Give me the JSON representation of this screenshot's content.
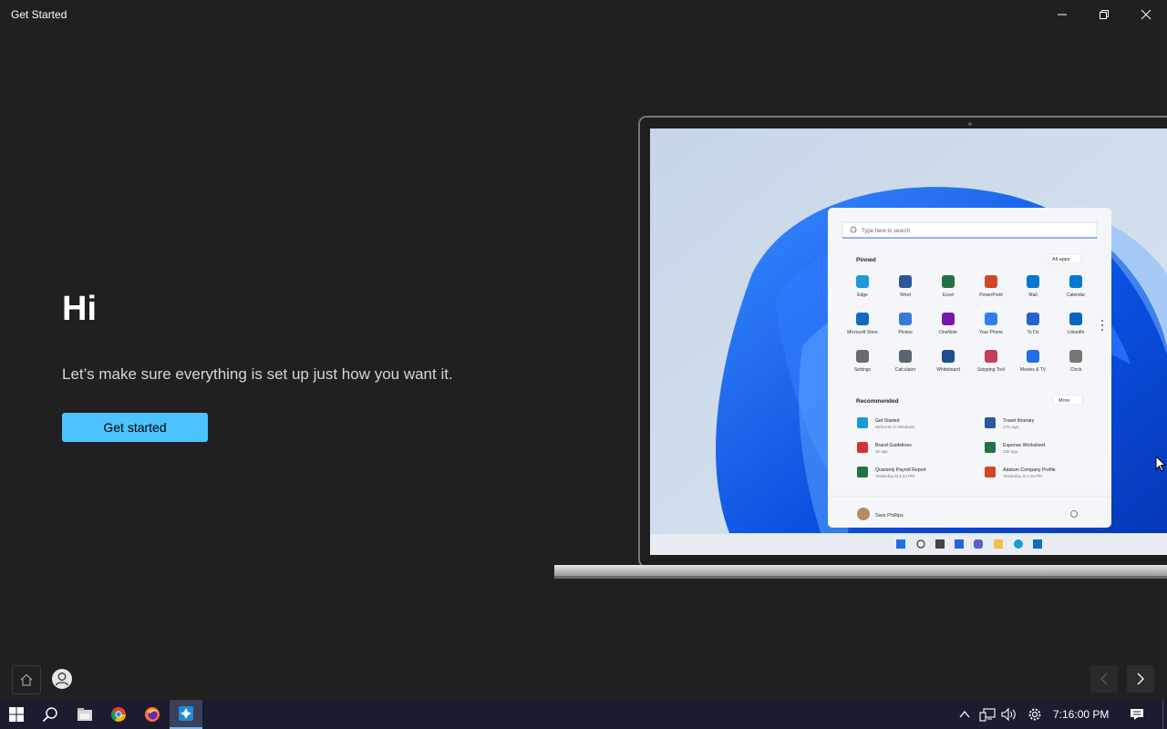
{
  "window": {
    "title": "Get Started"
  },
  "main": {
    "heading": "Hi",
    "subtitle": "Let’s make sure everything is set up just how you want it.",
    "button_label": "Get started"
  },
  "screen": {
    "search_placeholder": "Type here to search",
    "pinned_label": "Pinned",
    "all_apps_label": "All apps",
    "pinned_apps": [
      "Edge",
      "Word",
      "Excel",
      "PowerPoint",
      "Mail",
      "Calendar",
      "Microsoft Store",
      "Photos",
      "OneNote",
      "Your Phone",
      "To Do",
      "LinkedIn",
      "Settings",
      "Calculator",
      "Whiteboard",
      "Snipping Tool",
      "Movies & TV",
      "Clock"
    ],
    "recommended_label": "Recommended",
    "more_label": "More",
    "recommended": [
      {
        "title": "Get Started",
        "sub": "Welcome to Windows"
      },
      {
        "title": "Travel Itinerary",
        "sub": "17m ago"
      },
      {
        "title": "Brand Guidelines",
        "sub": "2h ago"
      },
      {
        "title": "Expense Worksheet",
        "sub": "12h ago"
      },
      {
        "title": "Quarterly Payroll Report",
        "sub": "Yesterday at 4:24 PM"
      },
      {
        "title": "Adatum Company Profile",
        "sub": "Yesterday at 1:15 PM"
      }
    ],
    "user_name": "Sara Phillips"
  },
  "taskbar": {
    "time": "7:16:00 PM"
  },
  "colors": {
    "accent": "#4cc2ff",
    "background": "#202020",
    "taskbar": "#1b1d2e"
  }
}
